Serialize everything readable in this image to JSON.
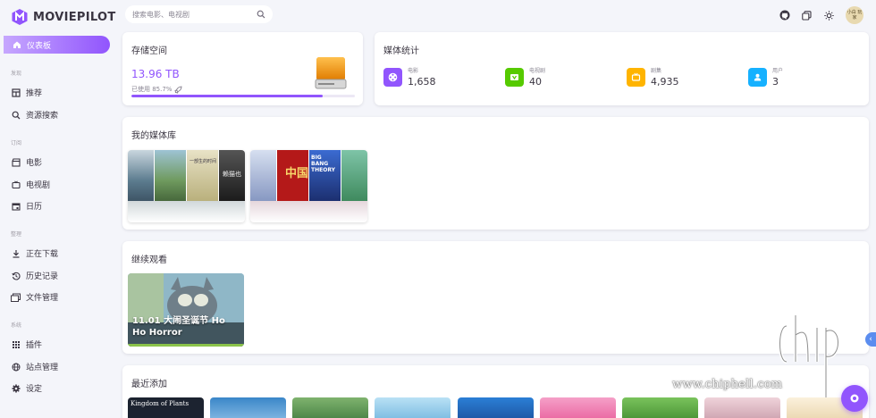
{
  "app": {
    "name": "MOVIEPILOT"
  },
  "search": {
    "placeholder": "搜索电影、电视剧"
  },
  "topbar": {
    "avatar_text": "小白 玩 家"
  },
  "sidebar": {
    "active": {
      "label": "仪表板"
    },
    "sections": [
      {
        "title": "发现",
        "items": [
          {
            "label": "推荐",
            "icon": "recommend-icon"
          },
          {
            "label": "资源搜索",
            "icon": "search-icon"
          }
        ]
      },
      {
        "title": "订阅",
        "items": [
          {
            "label": "电影",
            "icon": "clapperboard-icon"
          },
          {
            "label": "电视剧",
            "icon": "tv-icon"
          },
          {
            "label": "日历",
            "icon": "calendar-icon"
          }
        ]
      },
      {
        "title": "整理",
        "items": [
          {
            "label": "正在下载",
            "icon": "download-icon"
          },
          {
            "label": "历史记录",
            "icon": "history-icon"
          },
          {
            "label": "文件管理",
            "icon": "folder-icon"
          }
        ]
      },
      {
        "title": "系统",
        "items": [
          {
            "label": "插件",
            "icon": "grid-icon"
          },
          {
            "label": "站点管理",
            "icon": "globe-icon"
          },
          {
            "label": "设定",
            "icon": "gear-icon"
          }
        ]
      }
    ]
  },
  "storage": {
    "title": "存储空间",
    "value": "13.96 TB",
    "used_label": "已使用 85.7%",
    "used_fraction": 0.857
  },
  "media_stats": {
    "title": "媒体统计",
    "items": [
      {
        "label": "电影",
        "value": "1,658",
        "color": "#9155fd",
        "icon": "film-reel-icon"
      },
      {
        "label": "电视剧",
        "value": "40",
        "color": "#56ca00",
        "icon": "tv-icon"
      },
      {
        "label": "剧集",
        "value": "4,935",
        "color": "#ffb400",
        "icon": "episodes-icon"
      },
      {
        "label": "用户",
        "value": "3",
        "color": "#16b1ff",
        "icon": "user-icon"
      }
    ]
  },
  "library": {
    "title": "我的媒体库",
    "tiles": [
      {
        "posters": [
          "#6e8fa3",
          "#7aa070",
          "#cfc6a3",
          "#2d2d2d"
        ],
        "poster_texts": [
          "",
          "",
          "一部生的时间",
          "赖猫也"
        ]
      },
      {
        "posters": [
          "#b7c3d9",
          "#c41e1e",
          "#2b4fa0",
          "#4f9e6e"
        ],
        "poster_texts": [
          "",
          "中国",
          "BIG BANG THEORY",
          ""
        ]
      }
    ]
  },
  "continue": {
    "title": "继续观看",
    "item_text": "11.01 大闹圣诞节 Ho Ho Horror",
    "progress": 1.0
  },
  "recent": {
    "title": "最近添加",
    "posters": [
      {
        "color": "#1c2330",
        "text": "Kingdom of Plants"
      },
      {
        "color": "#3a86c8",
        "text": ""
      },
      {
        "color": "#5a8f5a",
        "text": ""
      },
      {
        "color": "#8ec7e8",
        "text": ""
      },
      {
        "color": "#2b7fd6",
        "text": ""
      },
      {
        "color": "#e85c9a",
        "text": ""
      },
      {
        "color": "#4a8f3a",
        "text": ""
      },
      {
        "color": "#d9b6c0",
        "text": ""
      },
      {
        "color": "#f4e4c8",
        "text": ""
      }
    ]
  },
  "watermark": {
    "url": "www.chiphell.com"
  }
}
